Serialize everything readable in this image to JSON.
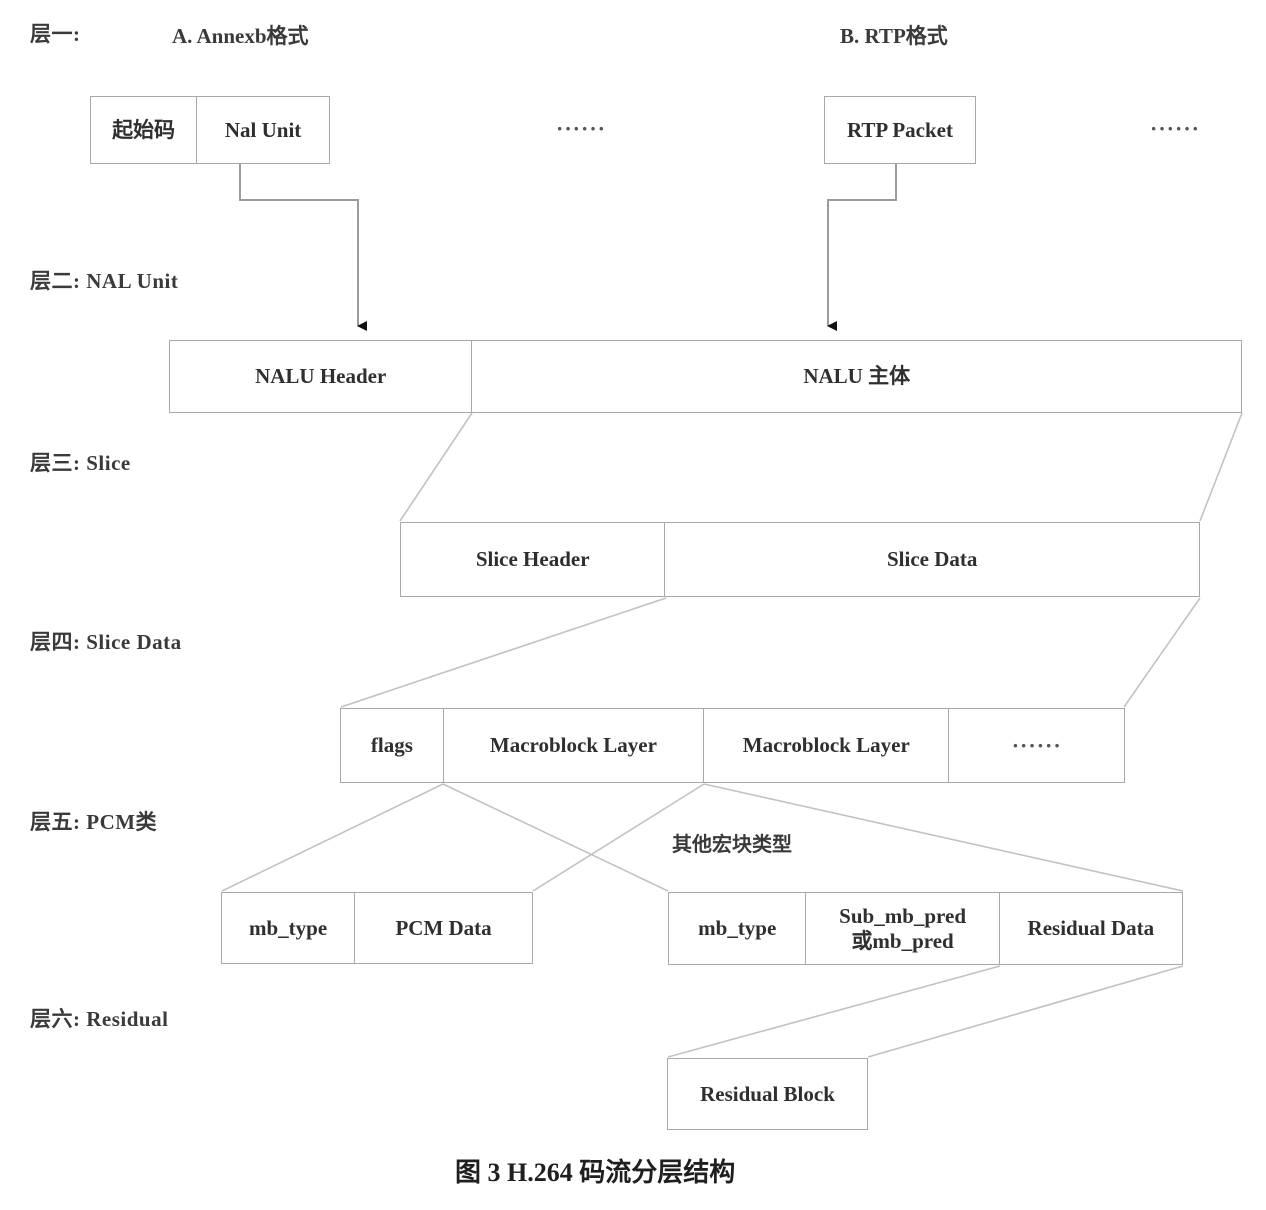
{
  "figure": {
    "caption": "图 3 H.264 码流分层结构"
  },
  "layers": [
    {
      "id": "layer1",
      "label": "层一:"
    },
    {
      "id": "layer2",
      "label": "层二: NAL Unit"
    },
    {
      "id": "layer3",
      "label": "层三: Slice"
    },
    {
      "id": "layer4",
      "label": "层四: Slice Data"
    },
    {
      "id": "layer5",
      "label": "层五: PCM类"
    },
    {
      "id": "layer6",
      "label": "层六: Residual"
    }
  ],
  "headings": {
    "format_a": "A. Annexb格式",
    "format_b": "B. RTP格式"
  },
  "notes": {
    "other_macroblock_types": "其他宏块类型"
  },
  "ellipsis": {
    "annexb_more": "······",
    "rtp_more": "······"
  },
  "boxes": {
    "annexb": {
      "cells": [
        {
          "text": "起始码"
        },
        {
          "text": "Nal Unit"
        }
      ]
    },
    "rtp": {
      "cells": [
        {
          "text": "RTP Packet"
        }
      ]
    },
    "nal_unit": {
      "cells": [
        {
          "text": "NALU Header"
        },
        {
          "text": "NALU 主体"
        }
      ]
    },
    "slice": {
      "cells": [
        {
          "text": "Slice Header"
        },
        {
          "text": "Slice Data"
        }
      ]
    },
    "slice_data": {
      "cells": [
        {
          "text": "flags"
        },
        {
          "text": "Macroblock Layer"
        },
        {
          "text": "Macroblock Layer"
        },
        {
          "text": "······"
        }
      ]
    },
    "pcm_macroblock": {
      "cells": [
        {
          "text": "mb_type"
        },
        {
          "text": "PCM Data"
        }
      ]
    },
    "other_macroblock": {
      "cells": [
        {
          "text": "mb_type"
        },
        {
          "text": "Sub_mb_pred\n或mb_pred"
        },
        {
          "text": "Residual Data"
        }
      ]
    },
    "residual": {
      "cells": [
        {
          "text": "Residual Block"
        }
      ]
    }
  },
  "colors": {
    "box_border": "#a8a8a8",
    "connector": "#b0b0b0",
    "arrow_fill": "#111111",
    "text": "#2f2f2f",
    "background": "#ffffff"
  }
}
